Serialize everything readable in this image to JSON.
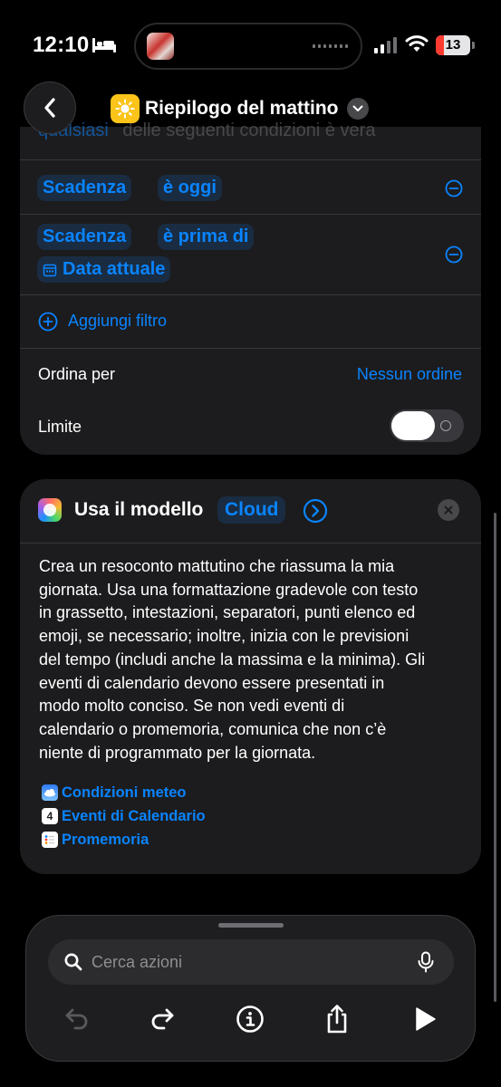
{
  "status_bar": {
    "time": "12:10",
    "battery": "13",
    "icons": [
      "bed-icon",
      "signal-icon",
      "wifi-icon",
      "battery-icon"
    ]
  },
  "header": {
    "back_icon": "chevron-left-icon",
    "title": "Riepilogo del mattino",
    "title_icon": "sun-icon",
    "ghost_line_1": "qualsiasi",
    "ghost_line_2": "delle seguenti condizioni è vera"
  },
  "filters": {
    "rows": [
      {
        "field": "Scadenza",
        "operator": "è oggi"
      },
      {
        "field": "Scadenza",
        "operator": "è prima di",
        "value": "Data attuale"
      }
    ],
    "add_filter": "Aggiungi filtro",
    "sort_label": "Ordina per",
    "sort_value": "Nessun ordine",
    "limit_label": "Limite",
    "limit_enabled": false
  },
  "model_action": {
    "title": "Usa il modello",
    "model": "Cloud",
    "prompt_lines": [
      "Crea un resoconto mattutino che riassuma la mia",
      "giornata. Usa una formattazione gradevole con testo",
      "in grassetto, intestazioni, separatori, punti elenco ed",
      "emoji, se necessario; inoltre, inizia con le previsioni",
      "del tempo (includi anche la massima e la minima). Gli",
      "eventi di calendario devono essere presentati in",
      "modo molto conciso. Se non vedi eventi di",
      "calendario o promemoria, comunica che non c’è",
      "niente di programmato per la giornata."
    ],
    "variables": [
      {
        "label": "Condizioni meteo",
        "icon": "weather-icon"
      },
      {
        "label": "Eventi di Calendario",
        "icon": "calendar-icon",
        "icon_text": "4"
      },
      {
        "label": "Promemoria",
        "icon": "reminders-icon"
      }
    ]
  },
  "bottom_bar": {
    "search_placeholder": "Cerca azioni",
    "tools": [
      "undo-icon",
      "redo-icon",
      "info-icon",
      "share-icon",
      "play-icon"
    ]
  },
  "colors": {
    "accent": "#0a84ff",
    "card": "#1c1c1e",
    "background": "#000000"
  }
}
